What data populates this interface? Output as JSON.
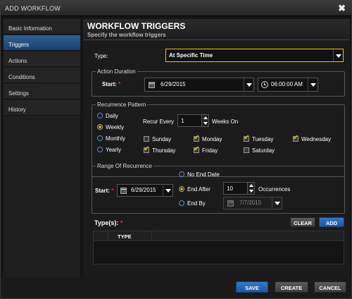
{
  "window": {
    "title": "ADD WORKFLOW",
    "close_glyph": "✖"
  },
  "sidebar": {
    "items": [
      {
        "label": "Basic Information"
      },
      {
        "label": "Triggers",
        "active": true
      },
      {
        "label": "Actions"
      },
      {
        "label": "Conditions"
      },
      {
        "label": "Settings"
      },
      {
        "label": "History"
      }
    ]
  },
  "header": {
    "title": "WORKFLOW TRIGGERS",
    "subtitle": "Specify the workflow triggers"
  },
  "type_field": {
    "label": "Type:",
    "value": "At Specific Time",
    "accent": "#f1c40f"
  },
  "action_duration": {
    "legend": "Action Duration",
    "start_label": "Start:",
    "required_mark": "*",
    "date": "6/29/2015",
    "time": "06:00:00 AM",
    "date_icon": "calendar-icon",
    "time_icon": "clock-icon"
  },
  "recurrence": {
    "legend": "Recurrence Pattern",
    "options": [
      "Daily",
      "Weekly",
      "Monthly",
      "Yearly"
    ],
    "selected": "Weekly",
    "recur_every_label": "Recur Every",
    "recur_every_value": "1",
    "weeks_on_label": "Weeks On",
    "days": [
      {
        "label": "Sunday",
        "checked": false
      },
      {
        "label": "Monday",
        "checked": true
      },
      {
        "label": "Tuesday",
        "checked": true
      },
      {
        "label": "Wednesday",
        "checked": true
      },
      {
        "label": "Thursday",
        "checked": true
      },
      {
        "label": "Friday",
        "checked": true
      },
      {
        "label": "Saturday",
        "checked": false
      }
    ]
  },
  "range": {
    "legend": "Range Of Recurrence",
    "start_label": "Start:",
    "required_mark": "*",
    "start_date": "6/29/2015",
    "no_end_label": "No End Date",
    "end_after_label": "End After",
    "end_after_value": "10",
    "occurrences_label": "Occurrences",
    "end_by_label": "End By",
    "end_by_date": "7/7/2015",
    "selected": "End After"
  },
  "types": {
    "label": "Type(s):",
    "required_mark": "*",
    "clear_label": "CLEAR",
    "add_label": "ADD",
    "column_header": "TYPE"
  },
  "footer": {
    "save_label": "SAVE",
    "create_label": "CREATE",
    "cancel_label": "CANCEL"
  },
  "colors": {
    "accent_blue": "#2a6bbf",
    "checkbox_check": "#e8c000",
    "required": "#e33333"
  }
}
